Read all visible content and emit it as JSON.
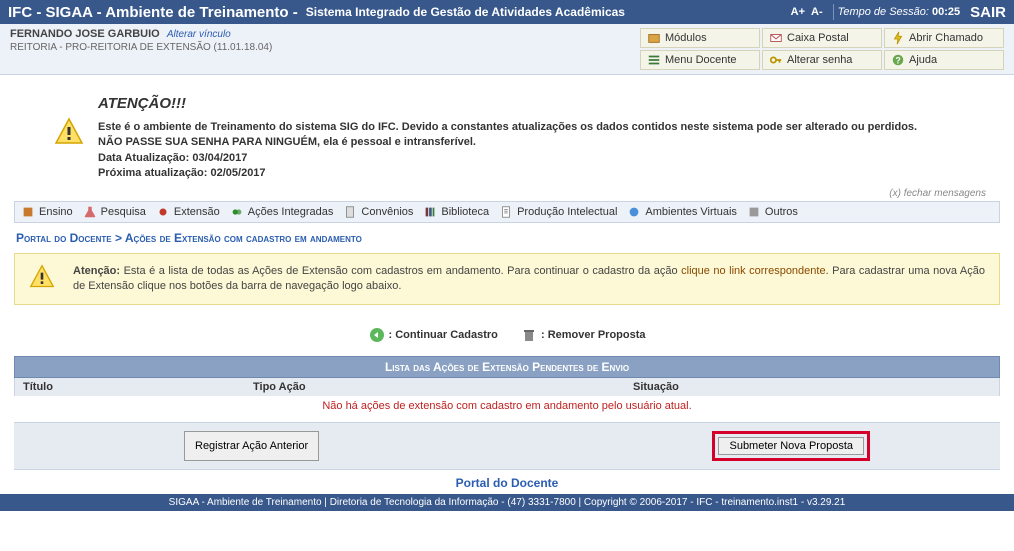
{
  "topbar": {
    "app": "IFC - SIGAA - Ambiente de Treinamento -",
    "subtitle": "Sistema Integrado de Gestão de Atividades Acadêmicas",
    "font_inc": "A+",
    "font_dec": "A-",
    "session_label": "Tempo de Sessão:",
    "session_time": "00:25",
    "logout": "SAIR"
  },
  "user": {
    "name": "FERNANDO JOSE GARBUIO",
    "alterar": "Alterar vínculo",
    "unit": "REITORIA - PRO-REITORIA DE EXTENSÃO (11.01.18.04)"
  },
  "quicklinks": {
    "modulos": "Módulos",
    "caixa": "Caixa Postal",
    "abrir": "Abrir Chamado",
    "menu": "Menu Docente",
    "senha": "Alterar senha",
    "ajuda": "Ajuda"
  },
  "alert": {
    "title": "ATENÇÃO!!!",
    "line1": "Este é o ambiente de Treinamento do sistema SIG do IFC. Devido a constantes atualizações os dados contidos neste sistema pode ser alterado ou perdidos.",
    "line2": "NÃO PASSE SUA SENHA PARA NINGUÉM, ela é pessoal e intransferível.",
    "line3": "Data Atualização: 03/04/2017",
    "line4": "Próxima atualização: 02/05/2017",
    "close": "(x) fechar mensagens"
  },
  "menu": {
    "items": [
      "Ensino",
      "Pesquisa",
      "Extensão",
      "Ações Integradas",
      "Convênios",
      "Biblioteca",
      "Produção Intelectual",
      "Ambientes Virtuais",
      "Outros"
    ]
  },
  "breadcrumb": {
    "a": "Portal do Docente",
    "sep": ">",
    "b": "Ações de Extensão com cadastro em andamento"
  },
  "notice": {
    "label": "Atenção:",
    "text1": " Esta é a lista de todas as Ações de Extensão com cadastros em andamento. Para continuar o cadastro da ação ",
    "link": "clique no link correspondente",
    "text2": ". Para cadastrar uma nova Ação de Extensão clique nos botões da barra de navegação logo abaixo."
  },
  "legend": {
    "continuar": ": Continuar Cadastro",
    "remover": ": Remover Proposta"
  },
  "table": {
    "title": "Lista das Ações de Extensão Pendentes de Envio",
    "cols": {
      "c1": "Título",
      "c2": "Tipo Ação",
      "c3": "Situação"
    },
    "empty": "Não há ações de extensão com cadastro em andamento pelo usuário atual."
  },
  "buttons": {
    "registrar": "Registrar Ação Anterior",
    "submeter": "Submeter Nova Proposta"
  },
  "portal_link": "Portal do Docente",
  "footer": "SIGAA - Ambiente de Treinamento | Diretoria de Tecnologia da Informação - (47) 3331-7800 | Copyright © 2006-2017 - IFC - treinamento.inst1 - v3.29.21"
}
